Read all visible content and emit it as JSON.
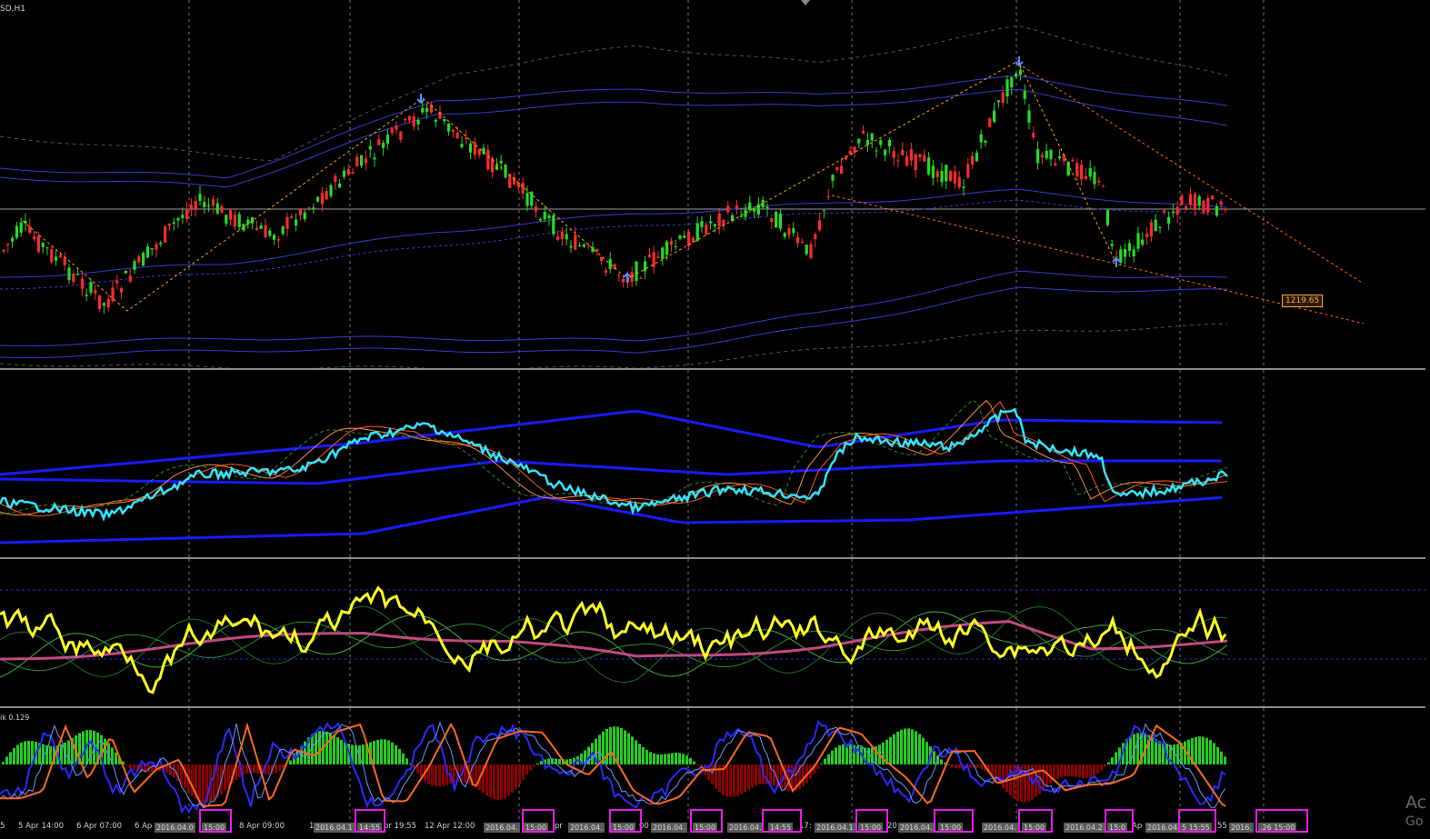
{
  "chart_window": {
    "title": "SD,H1"
  },
  "main_chart": {
    "price_label": "1219.65",
    "accent_colors": {
      "bull": "#22dd22",
      "bear": "#ff2a2a",
      "band": "#3a3aff",
      "zigzag": "#ffa500"
    },
    "markers": [
      "down-arrow-icon",
      "up-arrow-icon"
    ]
  },
  "indicator_3": {
    "label": "ik 0.129"
  },
  "time_axis": {
    "ticks": [
      {
        "text": "5"
      },
      {
        "text": "5 Apr 14:00"
      },
      {
        "text": "6 Apr 07:00"
      },
      {
        "text": "6 Ap"
      },
      {
        "text": "8 Apr 09:00"
      },
      {
        "text": "1"
      },
      {
        "text": "pr 19:55"
      },
      {
        "text": "12 Apr 12:00"
      },
      {
        "text": "pr"
      },
      {
        "text": "00"
      },
      {
        "text": "17:"
      },
      {
        "text": "20"
      },
      {
        "text": "Ap"
      },
      {
        "text": "55"
      }
    ],
    "boxes": [
      {
        "text": "2016.04.0"
      },
      {
        "text": "15:00"
      },
      {
        "text": "2016.04.1"
      },
      {
        "text": "14:55"
      },
      {
        "text": "2016.04."
      },
      {
        "text": "15:00"
      },
      {
        "text": "2016.04."
      },
      {
        "text": "15:00"
      },
      {
        "text": "2016.04."
      },
      {
        "text": "15:00"
      },
      {
        "text": "2016.04."
      },
      {
        "text": "14:55"
      },
      {
        "text": "2016.04.1"
      },
      {
        "text": "15:00"
      },
      {
        "text": "2016.04."
      },
      {
        "text": "15:00"
      },
      {
        "text": "2016.04."
      },
      {
        "text": "15:00"
      },
      {
        "text": "2016.04.2"
      },
      {
        "text": "15:0"
      },
      {
        "text": "2016.04."
      },
      {
        "text": "5 15:55"
      },
      {
        "text": "2016."
      },
      {
        "text": ".26 15:00"
      }
    ]
  },
  "watermark": {
    "line1": "Ac",
    "line2": "Go"
  }
}
